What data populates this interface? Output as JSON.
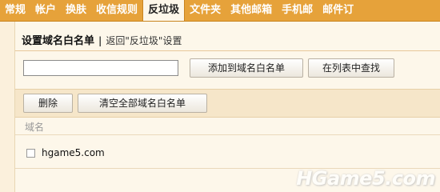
{
  "tabs": [
    {
      "label": "常规",
      "active": false
    },
    {
      "label": "帐户",
      "active": false
    },
    {
      "label": "换肤",
      "active": false
    },
    {
      "label": "收信规则",
      "active": false
    },
    {
      "label": "反垃圾",
      "active": true
    },
    {
      "label": "文件夹",
      "active": false
    },
    {
      "label": "其他邮箱",
      "active": false
    },
    {
      "label": "手机邮",
      "active": false
    },
    {
      "label": "邮件订",
      "active": false
    }
  ],
  "header": {
    "title": "设置域名白名单",
    "separator": "|",
    "back_link": "返回\"反垃圾\"设置"
  },
  "search": {
    "value": "",
    "add_button": "添加到域名白名单",
    "find_button": "在列表中查找"
  },
  "toolbar": {
    "delete_button": "删除",
    "clear_all_button": "清空全部域名白名单"
  },
  "list": {
    "column_header": "域名",
    "rows": [
      {
        "domain": "hgame5.com",
        "checked": false
      }
    ]
  },
  "watermark": "HGame5.com",
  "colors": {
    "tab_bar": "#e6a23a",
    "panel_bg": "#fdf7ea",
    "toolbar_bg": "#f6e6c9"
  }
}
